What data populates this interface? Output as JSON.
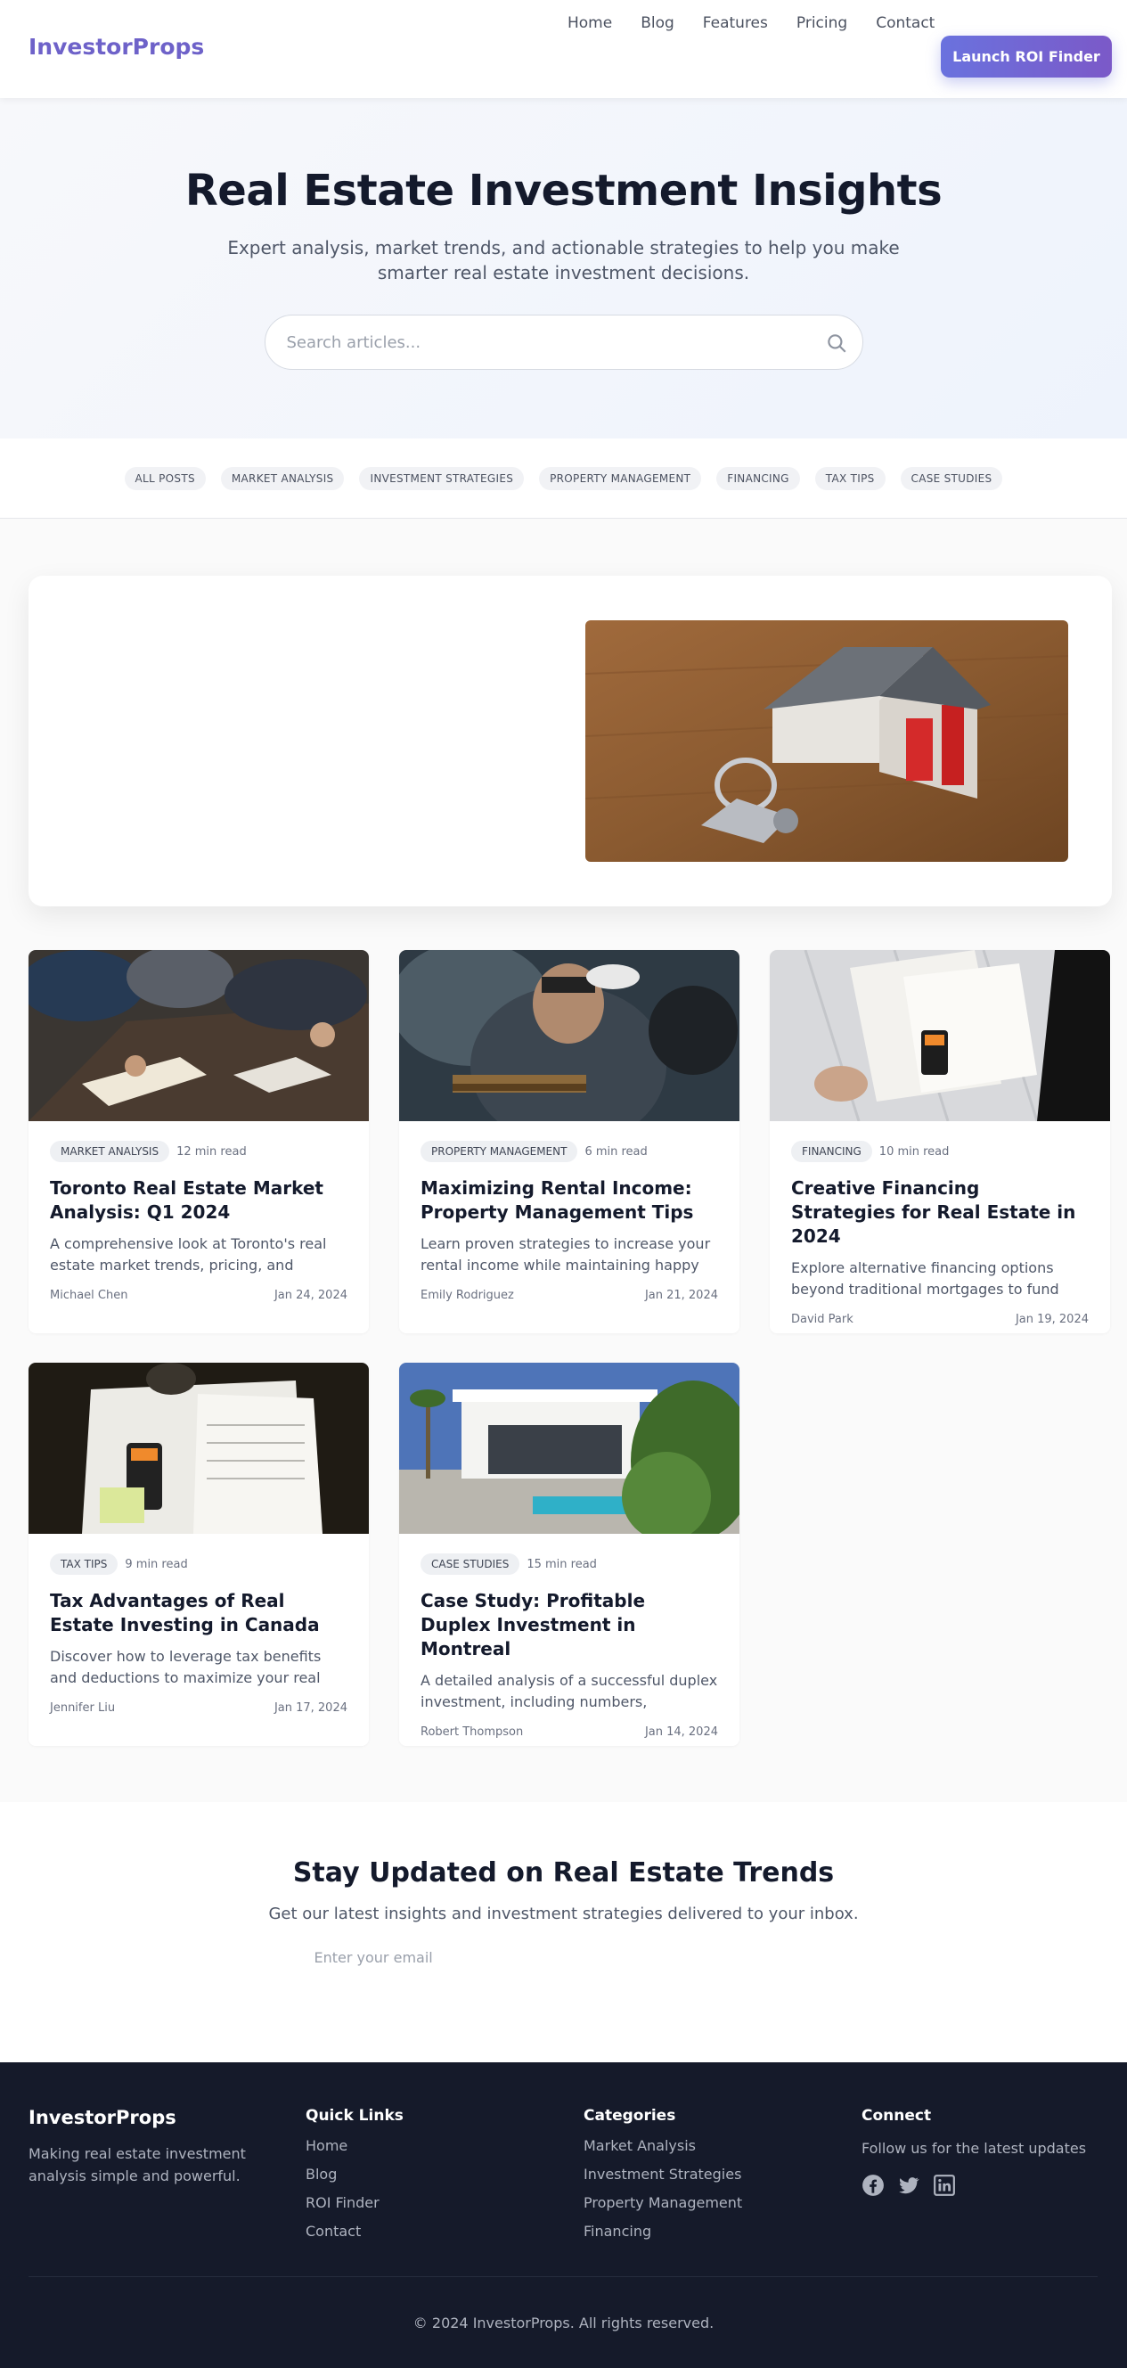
{
  "header": {
    "logo": "InvestorProps",
    "nav": [
      "Home",
      "Blog",
      "Features",
      "Pricing",
      "Contact"
    ],
    "cta": "Launch ROI Finder"
  },
  "hero": {
    "title": "Real Estate Investment Insights",
    "subtitle": "Expert analysis, market trends, and actionable strategies to help you make smarter real estate investment decisions.",
    "search_placeholder": "Search articles..."
  },
  "categories": [
    "ALL POSTS",
    "MARKET ANALYSIS",
    "INVESTMENT STRATEGIES",
    "PROPERTY MANAGEMENT",
    "FINANCING",
    "TAX TIPS",
    "CASE STUDIES"
  ],
  "posts": [
    {
      "tag": "MARKET ANALYSIS",
      "read": "12 min read",
      "title": "Toronto Real Estate Market Analysis: Q1 2024",
      "excerpt": "A comprehensive look at Toronto's real estate market trends, pricing, and investment opportunities.",
      "author": "Michael Chen",
      "date": "Jan 24, 2024"
    },
    {
      "tag": "PROPERTY MANAGEMENT",
      "read": "6 min read",
      "title": "Maximizing Rental Income: Property Management Tips",
      "excerpt": "Learn proven strategies to increase your rental income while maintaining happy tenants.",
      "author": "Emily Rodriguez",
      "date": "Jan 21, 2024"
    },
    {
      "tag": "FINANCING",
      "read": "10 min read",
      "title": "Creative Financing Strategies for Real Estate in 2024",
      "excerpt": "Explore alternative financing options beyond traditional mortgages to fund your real estate deals.",
      "author": "David Park",
      "date": "Jan 19, 2024"
    },
    {
      "tag": "TAX TIPS",
      "read": "9 min read",
      "title": "Tax Advantages of Real Estate Investing in Canada",
      "excerpt": "Discover how to leverage tax benefits and deductions to maximize your real estate returns.",
      "author": "Jennifer Liu",
      "date": "Jan 17, 2024"
    },
    {
      "tag": "CASE STUDIES",
      "read": "15 min read",
      "title": "Case Study: Profitable Duplex Investment in Montreal",
      "excerpt": "A detailed analysis of a successful duplex investment, including numbers, strategies, and lessons learned.",
      "author": "Robert Thompson",
      "date": "Jan 14, 2024"
    }
  ],
  "newsletter": {
    "title": "Stay Updated on Real Estate Trends",
    "subtitle": "Get our latest insights and investment strategies delivered to your inbox.",
    "placeholder": "Enter your email"
  },
  "footer": {
    "logo": "InvestorProps",
    "description": "Making real estate investment analysis simple and powerful.",
    "quick_links_title": "Quick Links",
    "quick_links": [
      "Home",
      "Blog",
      "ROI Finder",
      "Contact"
    ],
    "categories_title": "Categories",
    "categories": [
      "Market Analysis",
      "Investment Strategies",
      "Property Management",
      "Financing"
    ],
    "connect_title": "Connect",
    "connect_text": "Follow us for the latest updates",
    "socials": [
      "facebook-icon",
      "twitter-icon",
      "linkedin-icon"
    ],
    "copyright": "© 2024 InvestorProps. All rights reserved."
  }
}
